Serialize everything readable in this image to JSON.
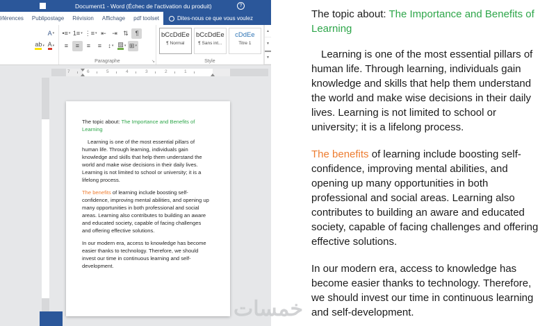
{
  "app": {
    "title": "Document1 - Word (Échec de l'activation du produit)",
    "tabs": [
      "Références",
      "Publipostage",
      "Révision",
      "Affichage",
      "pdf toolset"
    ],
    "tellme": "Dites-nous ce que vous voulez",
    "groups": {
      "paragraph": "Paragraphe",
      "style": "Style"
    },
    "styles": [
      {
        "sample": "bCcDdEe",
        "name": "¶ Normal"
      },
      {
        "sample": "bCcDdEe",
        "name": "¶ Sans int..."
      },
      {
        "sample": "cDdEe",
        "name": "Titre 1"
      }
    ],
    "ruler_numbers": [
      "7",
      "6",
      "5",
      "4",
      "3",
      "2",
      "1"
    ]
  },
  "icons": {
    "help": "?",
    "text_effects": "A",
    "highlight": "ab",
    "font_color": "A",
    "bullets": "•≡",
    "numbering": "1≡",
    "multilevel": "⋮≡",
    "outdent": "⇤",
    "indent": "⇥",
    "sort": "⇅",
    "pilcrow": "¶",
    "align_left": "≡",
    "align_center": "≡",
    "align_right": "≡",
    "align_justify": "≡",
    "line_spacing": "↕",
    "shading": "▨",
    "borders": "⊞",
    "caret": "▾",
    "launcher": "↘",
    "gallery_up": "▲",
    "gallery_down": "▼"
  },
  "document": {
    "heading": {
      "prefix": "The topic about: ",
      "highlight": "The Importance and Benefits of Learning"
    },
    "para1": "Learning is one of the most essential pillars of human life. Through learning, individuals gain knowledge and skills that help them understand the world and make wise decisions in their daily lives. Learning is not limited to school or university; it is a lifelong process.",
    "para2": {
      "lead": "The benefits",
      "rest": " of learning include boosting self-confidence, improving mental abilities, and opening up many opportunities in both professional and social areas. Learning also contributes to building an aware and educated society, capable of facing challenges and offering effective solutions."
    },
    "para3": "In our modern era, access to knowledge has become easier thanks to technology. Therefore, we should invest our time in continuous learning and self-development."
  },
  "watermark": "خمسات",
  "colors": {
    "word_blue": "#2b579a",
    "heading_green": "#2ea64a",
    "benefits_orange": "#ed7d31",
    "title1_blue": "#2e74b5",
    "shading_green": "#70ad47"
  }
}
